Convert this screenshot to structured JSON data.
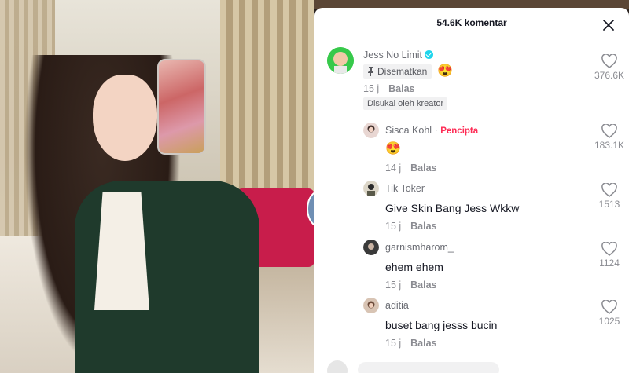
{
  "panel": {
    "title": "54.6K komentar",
    "close_icon": "close-icon"
  },
  "comments": [
    {
      "username": "Jess No Limit",
      "verified": true,
      "pinned_label": "Disematkan",
      "text_emoji": "😍",
      "time": "15 j",
      "reply_label": "Balas",
      "liked_by_creator": "Disukai oleh kreator",
      "likes": "376.6K"
    },
    {
      "username": "Sisca Kohl",
      "separator": "·",
      "creator_label": "Pencipta",
      "text": "😍",
      "time": "14 j",
      "reply_label": "Balas",
      "likes": "183.1K"
    },
    {
      "username": "Tik Toker",
      "text": "Give Skin Bang Jess Wkkw",
      "time": "15 j",
      "reply_label": "Balas",
      "likes": "1513"
    },
    {
      "username": "garnismharom_",
      "text": "ehem ehem",
      "time": "15 j",
      "reply_label": "Balas",
      "likes": "1124"
    },
    {
      "username": "aditia",
      "text": "buset bang jesss bucin",
      "time": "15 j",
      "reply_label": "Balas",
      "likes": "1025"
    }
  ],
  "colors": {
    "creator_accent": "#fe2c55",
    "verified_badge": "#20d5ec",
    "text_primary": "#161823",
    "text_secondary": "#8a8b91"
  }
}
